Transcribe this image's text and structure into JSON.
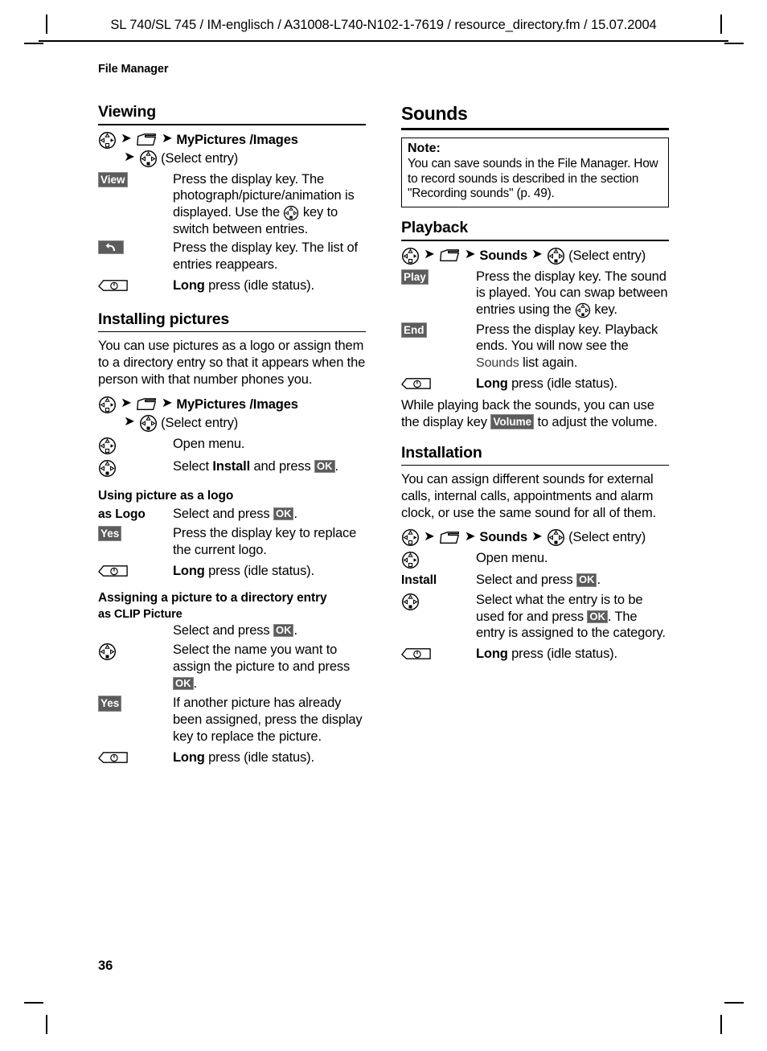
{
  "header": {
    "text": "SL 740/SL 745 / IM-englisch / A31008-L740-N102-1-7619 / resource_directory.fm / 15.07.2004"
  },
  "chapter": {
    "title": "File Manager"
  },
  "folio": {
    "page_number": "36"
  },
  "icons": {
    "nav_right": "nav-key-right-icon",
    "nav_down": "nav-key-down-icon",
    "folder": "folder-icon",
    "hangup": "hangup-key-icon",
    "arrow": "➔"
  },
  "left_column": {
    "viewing": {
      "heading": "Viewing",
      "path": {
        "line1_bold": "MyPictures /Images",
        "line2_text": "(Select entry)"
      },
      "steps": [
        {
          "key_type": "display-key",
          "key_label": "View",
          "desc_lines": [
            "Press the display key. The",
            "photograph/picture/animation",
            "is displayed.",
            "Use the ● key to switch",
            "between entries."
          ],
          "desc_a": "Press the display key. The photograph/picture/animation is displayed. Use the ",
          "desc_b": " key to switch between entries."
        },
        {
          "key_type": "display-key-back",
          "key_label": "back",
          "desc": "Press the display key. The list of entries reappears."
        },
        {
          "key_type": "hangup-key",
          "desc_bold": "Long",
          "desc": " press (idle status)."
        }
      ]
    },
    "installing_pictures": {
      "heading": "Installing pictures",
      "intro": "You can use pictures as a logo or assign them to a directory entry so that it appears when the person with that number phones you.",
      "path": {
        "line1_bold": "MyPictures /Images",
        "line2_text": "(Select entry)"
      },
      "steps": [
        {
          "key_type": "nav-right",
          "desc": "Open menu."
        },
        {
          "key_type": "nav-down",
          "desc_a": "Select ",
          "desc_bold": "Install",
          "desc_b": " and press ",
          "badge": "OK",
          "desc_c": "."
        }
      ],
      "using_picture_as_logo": {
        "heading": "Using picture as a logo",
        "steps": [
          {
            "key_type": "text",
            "key_label": "as Logo",
            "desc_a": "Select and press ",
            "badge": "OK",
            "desc_c": "."
          },
          {
            "key_type": "display-key",
            "key_label": "Yes",
            "desc": "Press the display key to replace the current logo."
          },
          {
            "key_type": "hangup-key",
            "desc_bold": "Long",
            "desc": " press (idle status)."
          }
        ]
      },
      "assigning_picture": {
        "heading": "Assigning a picture to a directory entry",
        "subheading": "as CLIP Picture",
        "steps": [
          {
            "key_type": "none",
            "desc_a": "Select and press ",
            "badge": "OK",
            "desc_c": "."
          },
          {
            "key_type": "nav-down",
            "desc_a": "Select the name you want to assign the picture to and press ",
            "badge": "OK",
            "desc_c": "."
          },
          {
            "key_type": "display-key",
            "key_label": "Yes",
            "desc": "If another picture has already been assigned, press the display key to replace the picture."
          },
          {
            "key_type": "hangup-key",
            "desc_bold": "Long",
            "desc": " press (idle status)."
          }
        ]
      }
    }
  },
  "right_column": {
    "sounds": {
      "heading": "Sounds",
      "note": {
        "title": "Note:",
        "text": "You can save sounds in the File Manager. How to record sounds is described in the section \"Recording sounds\" (p. 49)."
      },
      "playback": {
        "heading": "Playback",
        "path": {
          "bold": "Sounds",
          "tail": "(Select entry)"
        },
        "steps": [
          {
            "key_type": "display-key",
            "key_label": "Play",
            "desc_a": "Press the display key. The sound is played. You can swap between entries using the ",
            "desc_b": " key."
          },
          {
            "key_type": "display-key",
            "key_label": "End",
            "desc_a": "Press the display key. Playback ends. You will now see the ",
            "desc_screen": "Sounds",
            "desc_b": " list again."
          },
          {
            "key_type": "hangup-key",
            "desc_bold": "Long",
            "desc": " press (idle status)."
          }
        ],
        "outro_a": "While playing back the sounds, you can use the display key ",
        "outro_badge": "Volume",
        "outro_b": " to adjust the volume."
      },
      "installation": {
        "heading": "Installation",
        "intro": "You can assign different sounds for external calls, internal calls, appointments and alarm clock, or use the same sound for all of them.",
        "path": {
          "bold": "Sounds",
          "tail": "(Select entry)"
        },
        "steps": [
          {
            "key_type": "nav-right",
            "desc": "Open menu."
          },
          {
            "key_type": "text",
            "key_label": "Install",
            "desc_a": "Select and press ",
            "badge": "OK",
            "desc_c": "."
          },
          {
            "key_type": "nav-down",
            "desc_a": "Select what the entry is to be used for and press ",
            "badge": "OK",
            "desc_b": ". The entry is assigned to the category."
          },
          {
            "key_type": "hangup-key",
            "desc_bold": "Long",
            "desc": " press (idle status)."
          }
        ]
      }
    }
  },
  "colors": {
    "display_key_bg": "#5c5c5c",
    "display_key_fg": "#ffffff",
    "text": "#000000",
    "screen_font": "#3b3b3b"
  }
}
